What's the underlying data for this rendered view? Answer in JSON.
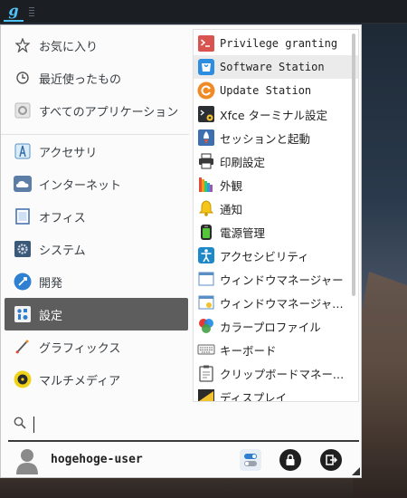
{
  "taskbar": {
    "launcher_glyph": "g"
  },
  "menu": {
    "favorites": [
      {
        "label": "お気に入り",
        "icon": "star-icon"
      },
      {
        "label": "最近使ったもの",
        "icon": "history-icon"
      },
      {
        "label": "すべてのアプリケーション",
        "icon": "all-apps-icon"
      }
    ],
    "categories": [
      {
        "label": "アクセサリ",
        "icon": "accessories-icon"
      },
      {
        "label": "インターネット",
        "icon": "cloud-icon"
      },
      {
        "label": "オフィス",
        "icon": "office-icon"
      },
      {
        "label": "システム",
        "icon": "system-gear-icon"
      },
      {
        "label": "開発",
        "icon": "development-icon"
      },
      {
        "label": "設定",
        "icon": "settings-icon",
        "selected": true
      },
      {
        "label": "グラフィックス",
        "icon": "graphics-icon"
      },
      {
        "label": "マルチメディア",
        "icon": "multimedia-icon"
      }
    ],
    "apps": [
      {
        "label": "Privilege granting",
        "icon": "privilege-icon"
      },
      {
        "label": "Software Station",
        "icon": "software-station-icon",
        "hover": true
      },
      {
        "label": "Update Station",
        "icon": "update-station-icon"
      },
      {
        "label": "Xfce ターミナル設定",
        "icon": "terminal-settings-icon"
      },
      {
        "label": "セッションと起動",
        "icon": "session-icon"
      },
      {
        "label": "印刷設定",
        "icon": "printer-icon"
      },
      {
        "label": "外観",
        "icon": "appearance-icon"
      },
      {
        "label": "通知",
        "icon": "bell-icon"
      },
      {
        "label": "電源管理",
        "icon": "power-icon"
      },
      {
        "label": "アクセシビリティ",
        "icon": "accessibility-icon"
      },
      {
        "label": "ウィンドウマネージャー",
        "icon": "window-manager-icon"
      },
      {
        "label": "ウィンドウマネージャー（詳細）",
        "icon": "window-manager-tweaks-icon"
      },
      {
        "label": "カラープロファイル",
        "icon": "color-profile-icon"
      },
      {
        "label": "キーボード",
        "icon": "keyboard-icon"
      },
      {
        "label": "クリップボードマネージャー",
        "icon": "clipboard-icon"
      },
      {
        "label": "ディスプレイ",
        "icon": "display-icon"
      }
    ],
    "search": {
      "value": "",
      "placeholder": ""
    },
    "user": {
      "name": "hogehoge-user"
    }
  }
}
